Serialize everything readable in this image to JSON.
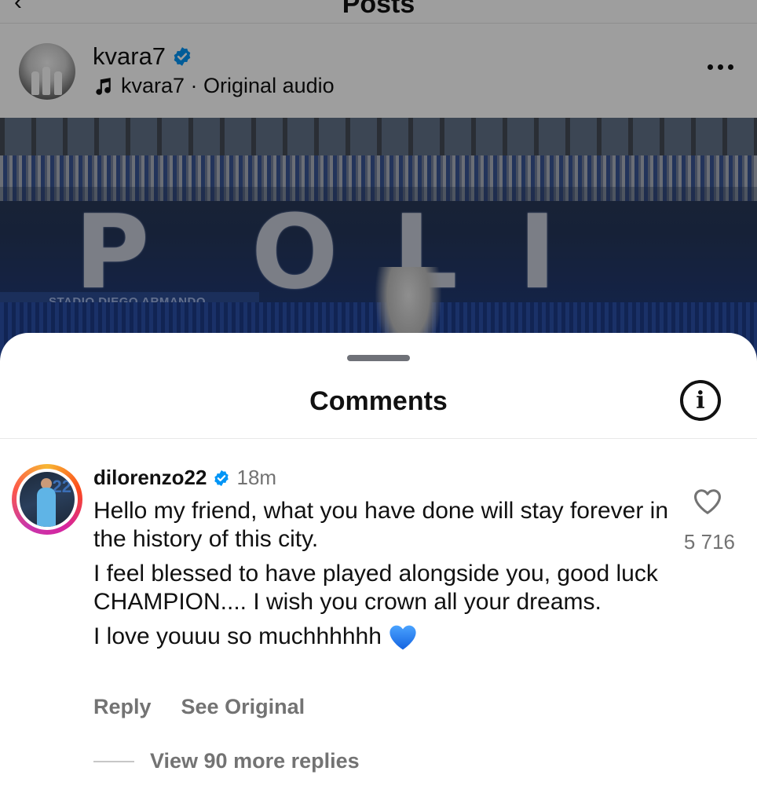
{
  "topbar": {
    "title": "Posts"
  },
  "post": {
    "author": "kvara7",
    "audio": "kvara7 · Original audio",
    "image": {
      "big_letters": [
        "P",
        "O",
        "L",
        "I"
      ],
      "banner": "STADIO DIEGO ARMANDO MARADONA"
    }
  },
  "sheet": {
    "title": "Comments",
    "info_icon": "i"
  },
  "comment": {
    "username": "dilorenzo22",
    "time": "18m",
    "avatar_number": "22",
    "paragraphs": [
      "Hello my friend, what you have done will stay forever in the history of this city.",
      "I feel blessed to have played alongside you, good luck CHAMPION.... I wish you crown all your dreams."
    ],
    "last_line": "I love youuu so muchhhhhh",
    "emoji": "blue-heart",
    "like_count": "5 716",
    "reply_label": "Reply",
    "see_original_label": "See Original",
    "view_replies_label": "View 90 more replies"
  },
  "colors": {
    "verified": "#0095f6",
    "muted_text": "#737373",
    "heart_blue": "#1877f2"
  }
}
